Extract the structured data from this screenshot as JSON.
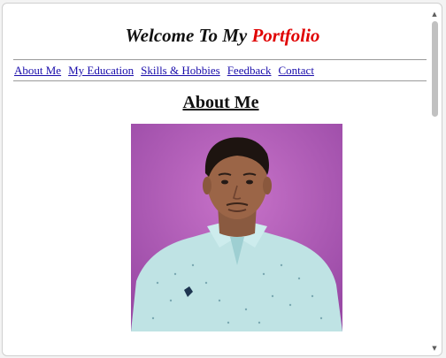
{
  "header": {
    "title_prefix": "Welcome To My",
    "title_accent": "Portfolio"
  },
  "nav": {
    "items": [
      {
        "label": "About Me"
      },
      {
        "label": "My Education"
      },
      {
        "label": "Skills & Hobbies"
      },
      {
        "label": "Feedback"
      },
      {
        "label": "Contact"
      }
    ]
  },
  "main": {
    "section_heading": "About Me"
  },
  "colors": {
    "title_accent": "#e00000",
    "link": "#1a0dab",
    "photo_background": "#b55dbb"
  }
}
